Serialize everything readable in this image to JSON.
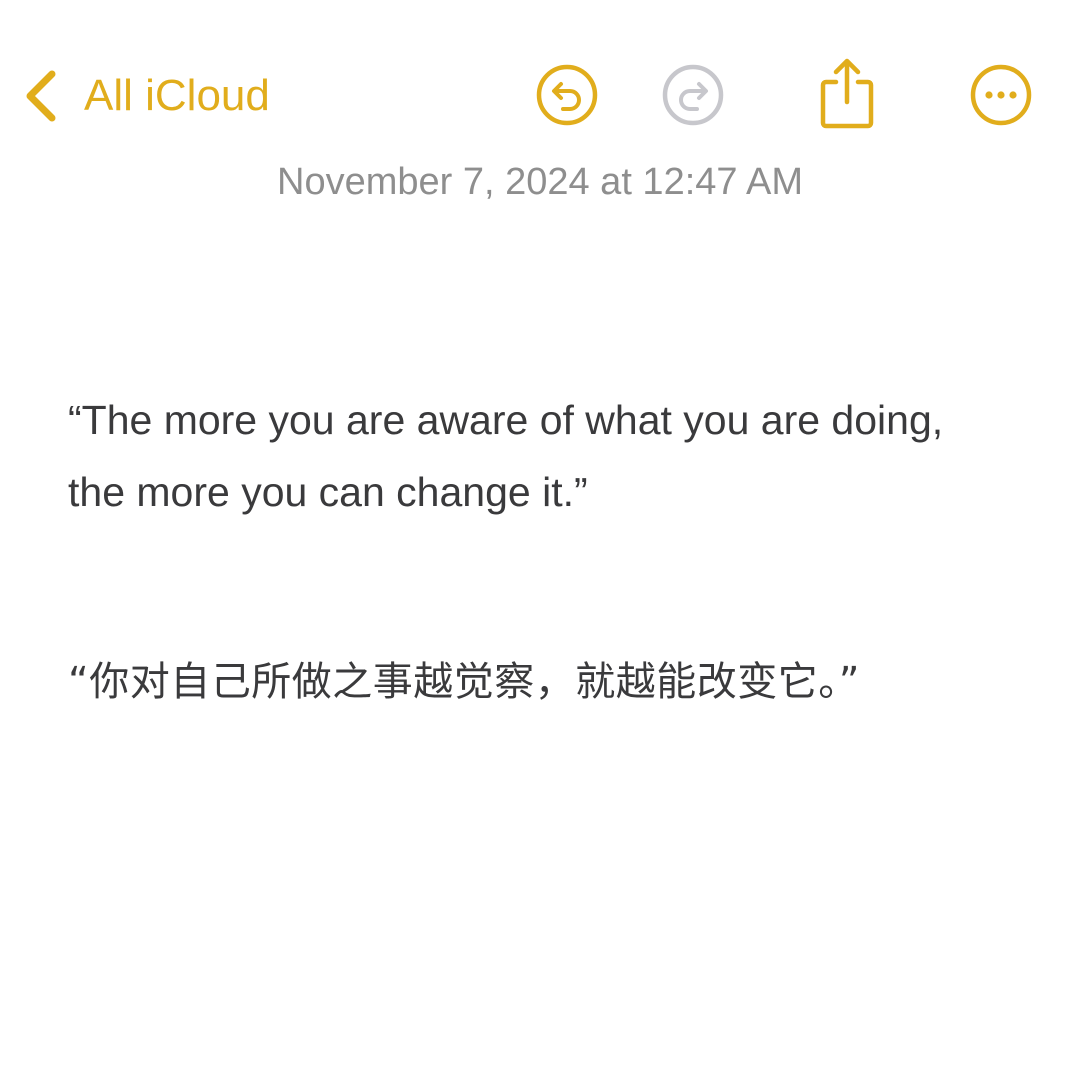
{
  "nav": {
    "back_label": "All iCloud",
    "icons": {
      "back": "chevron-left-icon",
      "undo": "undo-circle-icon",
      "redo": "redo-circle-icon",
      "share": "share-icon",
      "more": "ellipsis-circle-icon"
    },
    "redo_enabled": false
  },
  "note": {
    "date": "November 7, 2024 at 12:47 AM",
    "paragraphs": [
      "“The more you are aware of what you are doing, the more you can change it.”",
      "“你对自己所做之事越觉察，就越能改变它。”"
    ]
  },
  "colors": {
    "accent": "#E1AD1C",
    "disabled": "#C7C7CC",
    "date_text": "#8E8E8E",
    "body_text": "#3A3A3C",
    "background": "#FFFFFF"
  }
}
